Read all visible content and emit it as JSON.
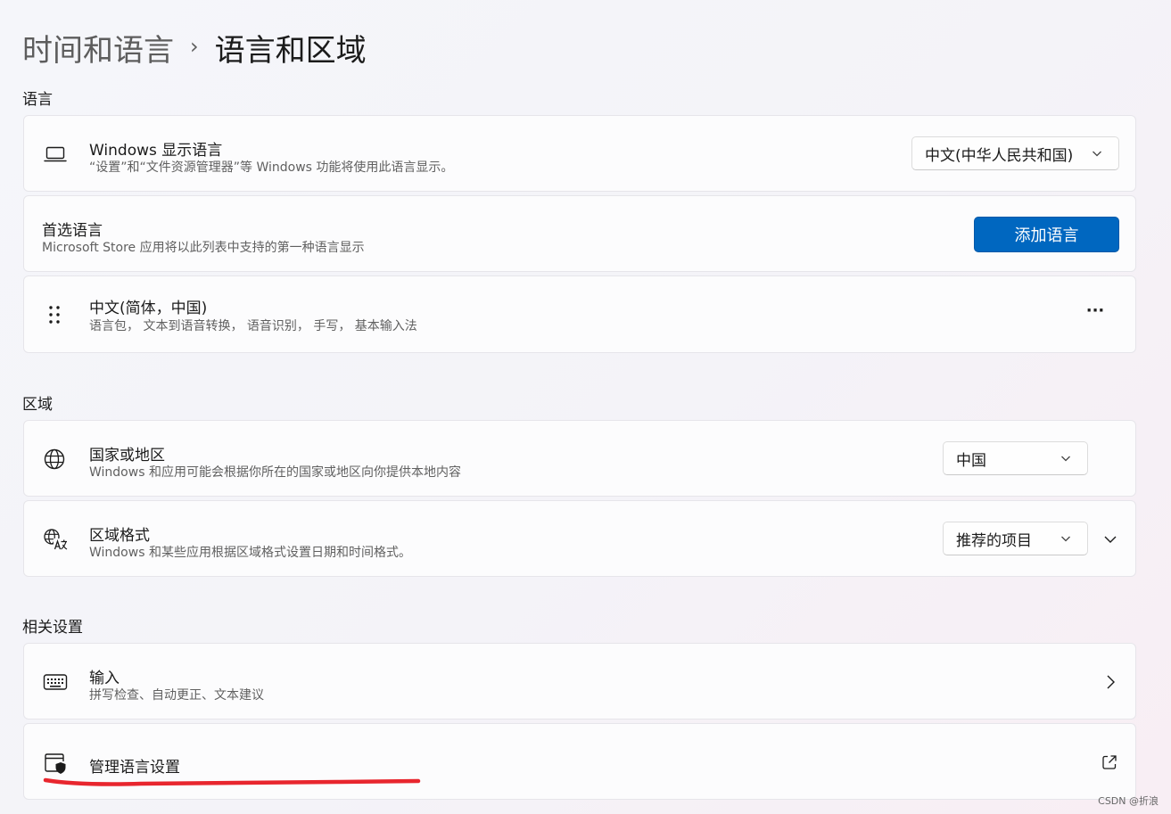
{
  "breadcrumb": {
    "parent": "时间和语言",
    "separator": "›",
    "current": "语言和区域"
  },
  "sections": {
    "language": "语言",
    "region": "区域",
    "related": "相关设置"
  },
  "display_language": {
    "icon": "laptop-icon",
    "title": "Windows 显示语言",
    "subtitle": "“设置”和“文件资源管理器”等 Windows 功能将使用此语言显示。",
    "value": "中文(中华人民共和国)"
  },
  "preferred_languages": {
    "title": "首选语言",
    "subtitle": "Microsoft Store 应用将以此列表中支持的第一种语言显示",
    "button": "添加语言"
  },
  "language_item": {
    "icon": "drag-handle-icon",
    "title": "中文(简体，中国)",
    "subtitle": "语言包， 文本到语音转换， 语音识别， 手写， 基本输入法",
    "more": "···"
  },
  "country": {
    "icon": "globe-icon",
    "title": "国家或地区",
    "subtitle": "Windows 和应用可能会根据你所在的国家或地区向你提供本地内容",
    "value": "中国"
  },
  "regional_format": {
    "icon": "language-format-icon",
    "title": "区域格式",
    "subtitle": "Windows 和某些应用根据区域格式设置日期和时间格式。",
    "value": "推荐的项目"
  },
  "typing": {
    "icon": "keyboard-icon",
    "title": "输入",
    "subtitle": "拼写检查、自动更正、文本建议"
  },
  "admin_language": {
    "icon": "admin-shield-window-icon",
    "title": "管理语言设置"
  },
  "colors": {
    "accent": "#0067c0",
    "annotation": "#e8262e"
  },
  "watermark": "CSDN @折浪"
}
